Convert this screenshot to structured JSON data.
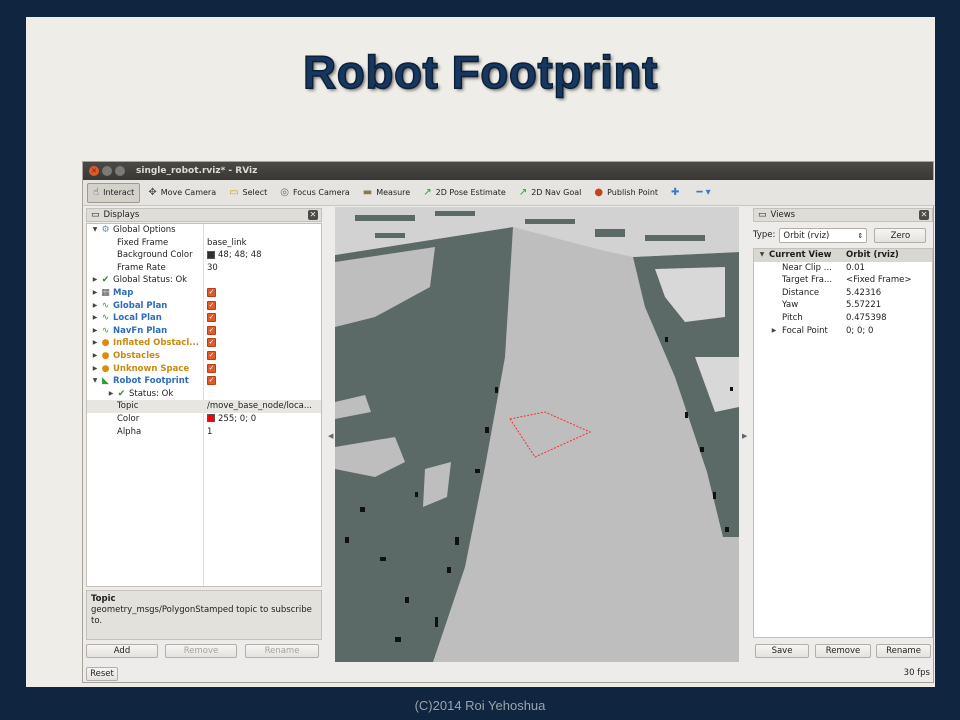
{
  "slide": {
    "title": "Robot Footprint",
    "footer": "(C)2014 Roi Yehoshua"
  },
  "window": {
    "title": "single_robot.rviz* - RViz"
  },
  "toolbar": [
    {
      "label": "Interact",
      "icon": "hand-icon",
      "glyph": "☝",
      "color": "#444444",
      "active": true
    },
    {
      "label": "Move Camera",
      "icon": "move-camera-icon",
      "glyph": "✥",
      "color": "#555555"
    },
    {
      "label": "Select",
      "icon": "select-icon",
      "glyph": "▭",
      "color": "#c9a400"
    },
    {
      "label": "Focus Camera",
      "icon": "focus-camera-icon",
      "glyph": "◎",
      "color": "#666666"
    },
    {
      "label": "Measure",
      "icon": "ruler-icon",
      "glyph": "▬",
      "color": "#8a7a45"
    },
    {
      "label": "2D Pose Estimate",
      "icon": "pose-estimate-icon",
      "glyph": "↗",
      "color": "#2ca02c"
    },
    {
      "label": "2D Nav Goal",
      "icon": "nav-goal-icon",
      "glyph": "↗",
      "color": "#2ca02c"
    },
    {
      "label": "Publish Point",
      "icon": "map-pin-icon",
      "glyph": "●",
      "color": "#c8411a"
    }
  ],
  "toolbar_extra": {
    "add_glyph": "✚",
    "remove_glyph": "━ ▾"
  },
  "displays": {
    "title": "Displays",
    "rows": [
      {
        "label": "Global Options",
        "arrow": "▼",
        "icon": "gear-icon",
        "glyph": "⚙",
        "iconColor": "#6688aa",
        "level": 0
      },
      {
        "label": "Fixed Frame",
        "value": "base_link",
        "level": 1
      },
      {
        "label": "Background Color",
        "value": "48; 48; 48",
        "swatch": "#303030",
        "level": 1
      },
      {
        "label": "Frame Rate",
        "value": "30",
        "level": 1
      },
      {
        "label": "Global Status: Ok",
        "arrow": "▶",
        "icon": "check-icon",
        "glyph": "✔",
        "iconColor": "#2b8a2b",
        "level": 0
      },
      {
        "label": "Map",
        "arrow": "▶",
        "icon": "grid-map-icon",
        "glyph": "▦",
        "iconColor": "#555555",
        "level": 0,
        "cls": "blue",
        "checked": true
      },
      {
        "label": "Global Plan",
        "arrow": "▶",
        "icon": "path-icon",
        "glyph": "∿",
        "iconColor": "#2ca02c",
        "level": 0,
        "cls": "blue",
        "checked": true
      },
      {
        "label": "Local Plan",
        "arrow": "▶",
        "icon": "path-icon",
        "glyph": "∿",
        "iconColor": "#2ca02c",
        "level": 0,
        "cls": "blue",
        "checked": true
      },
      {
        "label": "NavFn Plan",
        "arrow": "▶",
        "icon": "path-icon",
        "glyph": "∿",
        "iconColor": "#2ca02c",
        "level": 0,
        "cls": "blue",
        "checked": true
      },
      {
        "label": "Inflated Obstacl...",
        "arrow": "▶",
        "icon": "warning-icon",
        "glyph": "●",
        "iconColor": "#e08a0a",
        "level": 0,
        "cls": "orange",
        "checked": true
      },
      {
        "label": "Obstacles",
        "arrow": "▶",
        "icon": "warning-icon",
        "glyph": "●",
        "iconColor": "#e08a0a",
        "level": 0,
        "cls": "orange",
        "checked": true
      },
      {
        "label": "Unknown Space",
        "arrow": "▶",
        "icon": "warning-icon",
        "glyph": "●",
        "iconColor": "#e08a0a",
        "level": 0,
        "cls": "orange",
        "checked": true
      },
      {
        "label": "Robot Footprint",
        "arrow": "▼",
        "icon": "polygon-icon",
        "glyph": "◣",
        "iconColor": "#2ca02c",
        "level": 0,
        "cls": "blue",
        "checked": true
      },
      {
        "label": "Status: Ok",
        "arrow": "▶",
        "icon": "check-icon",
        "glyph": "✔",
        "iconColor": "#2b8a2b",
        "level": 1
      },
      {
        "label": "Topic",
        "value": "/move_base_node/loca...",
        "level": 1,
        "selected": true
      },
      {
        "label": "Color",
        "value": "255; 0; 0",
        "swatch": "#ff0000",
        "level": 1
      },
      {
        "label": "Alpha",
        "value": "1",
        "level": 1
      }
    ],
    "description": {
      "heading": "Topic",
      "text": "geometry_msgs/PolygonStamped topic to subscribe to."
    },
    "buttons": {
      "add": "Add",
      "remove": "Remove",
      "rename": "Rename"
    }
  },
  "views": {
    "title": "Views",
    "type_label": "Type:",
    "type_value": "Orbit (rviz)",
    "zero": "Zero",
    "rows": [
      {
        "label": "Current View",
        "value": "Orbit (rviz)",
        "arrow": "▼",
        "head": true
      },
      {
        "label": "Near Clip ...",
        "value": "0.01"
      },
      {
        "label": "Target Fra...",
        "value": "<Fixed Frame>"
      },
      {
        "label": "Distance",
        "value": "5.42316"
      },
      {
        "label": "Yaw",
        "value": "5.57221"
      },
      {
        "label": "Pitch",
        "value": "0.475398"
      },
      {
        "label": "Focal Point",
        "value": "0; 0; 0",
        "arrow": "▶"
      }
    ],
    "buttons": {
      "save": "Save",
      "remove": "Remove",
      "rename": "Rename"
    }
  },
  "footer_bar": {
    "reset": "Reset",
    "fps": "30 fps"
  },
  "colors": {
    "map_free": "#bebebe",
    "map_obstacle": "#5b6967",
    "footprint": "#ff2a2a"
  }
}
